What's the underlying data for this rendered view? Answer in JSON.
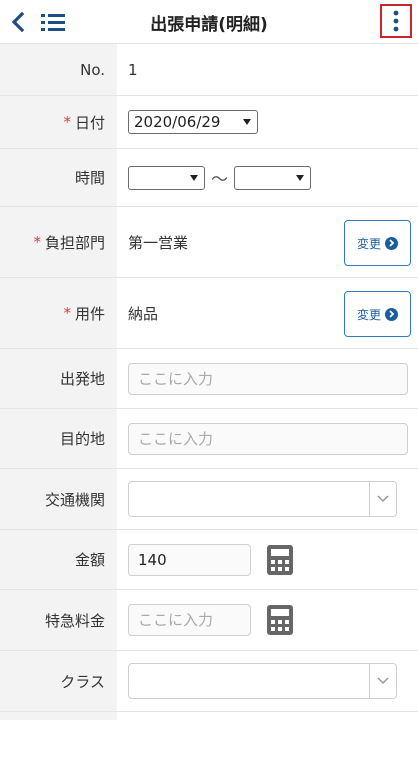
{
  "header": {
    "title": "出張申請(明細)"
  },
  "form": {
    "no": {
      "label": "No.",
      "value": "1"
    },
    "date": {
      "label": "日付",
      "required_mark": "*",
      "value": "2020/06/29"
    },
    "time": {
      "label": "時間",
      "separator": "〜",
      "start": "",
      "end": ""
    },
    "department": {
      "label": "負担部門",
      "required_mark": "*",
      "value": "第一営業",
      "button_label": "変更"
    },
    "purpose": {
      "label": "用件",
      "required_mark": "*",
      "value": "納品",
      "button_label": "変更"
    },
    "departure": {
      "label": "出発地",
      "value": "",
      "placeholder": "ここに入力"
    },
    "destination": {
      "label": "目的地",
      "value": "",
      "placeholder": "ここに入力"
    },
    "transport": {
      "label": "交通機関",
      "value": ""
    },
    "amount": {
      "label": "金額",
      "value": "140"
    },
    "express_fee": {
      "label": "特急料金",
      "value": "",
      "placeholder": "ここに入力"
    },
    "class": {
      "label": "クラス",
      "value": ""
    }
  },
  "colors": {
    "accent": "#1a5d9c",
    "required": "#e03b3b",
    "highlight_border": "#c9252d",
    "label_bg": "#f3f3f3"
  },
  "icons": {
    "back": "chevron-left-icon",
    "list": "list-icon",
    "more": "vertical-dots-icon",
    "calculator": "calculator-icon",
    "dropdown": "chevron-down-icon",
    "change": "arrow-right-circle-icon"
  }
}
